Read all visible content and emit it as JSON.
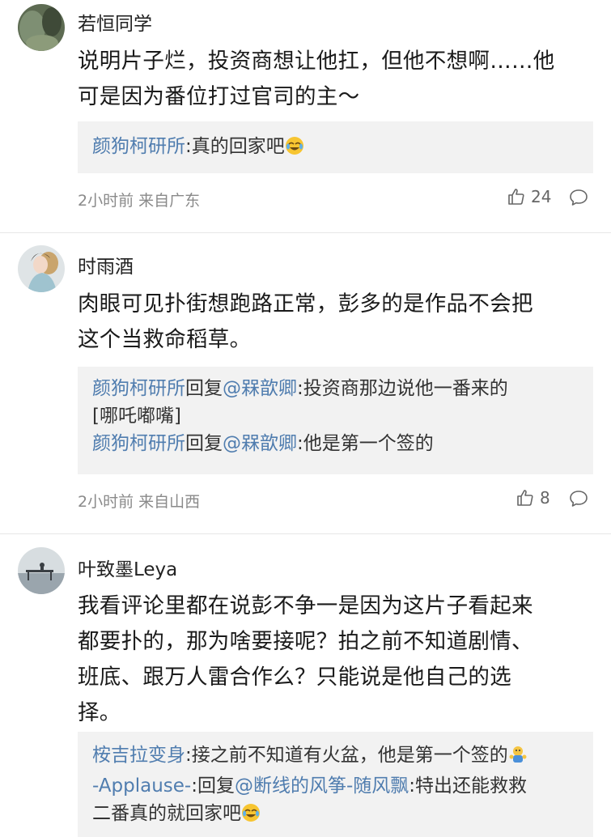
{
  "comments": [
    {
      "user": "若恒同学",
      "lines": [
        "说明片子烂，投资商想让他扛，但他不想啊……他",
        "可是因为番位打过官司的主～"
      ],
      "replies": [
        {
          "parts": [
            {
              "t": "颜狗柯研所",
              "c": "blue"
            },
            {
              "t": ":真的回家吧",
              "c": ""
            }
          ],
          "emoji": "laugh-cry"
        }
      ],
      "time": "2小时前 来自广东",
      "likes": "24"
    },
    {
      "user": "时雨酒",
      "lines": [
        "肉眼可见扑街想跑路正常，彭多的是作品不会把",
        "这个当救命稻草。"
      ],
      "replies": [
        {
          "parts": [
            {
              "t": "颜狗柯研所",
              "c": "blue"
            },
            {
              "t": "回复",
              "c": ""
            },
            {
              "t": "@槑歆卿",
              "c": "blue"
            },
            {
              "t": ":投资商那边说他一番来的",
              "c": ""
            }
          ]
        },
        {
          "parts": [
            {
              "t": "[哪吒嘟嘴]",
              "c": ""
            }
          ]
        },
        {
          "parts": [
            {
              "t": "颜狗柯研所",
              "c": "blue"
            },
            {
              "t": "回复",
              "c": ""
            },
            {
              "t": "@槑歆卿",
              "c": "blue"
            },
            {
              "t": ":他是第一个签的",
              "c": ""
            }
          ]
        }
      ],
      "time": "2小时前 来自山西",
      "likes": "8"
    },
    {
      "user": "叶致墨Leya",
      "lines": [
        "我看评论里都在说彭不争一是因为这片子看起来",
        "都要扑的，那为啥要接呢？拍之前不知道剧情、",
        "班底、跟万人雷合作么？只能说是他自己的选",
        "择。"
      ],
      "replies": [
        {
          "parts": [
            {
              "t": "桉吉拉变身",
              "c": "blue"
            },
            {
              "t": ":接之前不知道有火盆，他是第一个签的",
              "c": ""
            }
          ],
          "emoji": "applause-doll"
        },
        {
          "parts": [
            {
              "t": "-Applause-",
              "c": "blue"
            },
            {
              "t": ":回复",
              "c": ""
            },
            {
              "t": "@断线的风筝-随风飘",
              "c": "blue"
            },
            {
              "t": ":特出还能救救",
              "c": ""
            }
          ]
        },
        {
          "parts": [
            {
              "t": "二番真的就回家吧",
              "c": ""
            }
          ],
          "emoji": "laugh-cry"
        }
      ],
      "time": "",
      "likes": ""
    }
  ],
  "colors": {
    "link": "#507daf",
    "reply_bg": "#f2f2f2",
    "meta": "#8a8a8a"
  }
}
